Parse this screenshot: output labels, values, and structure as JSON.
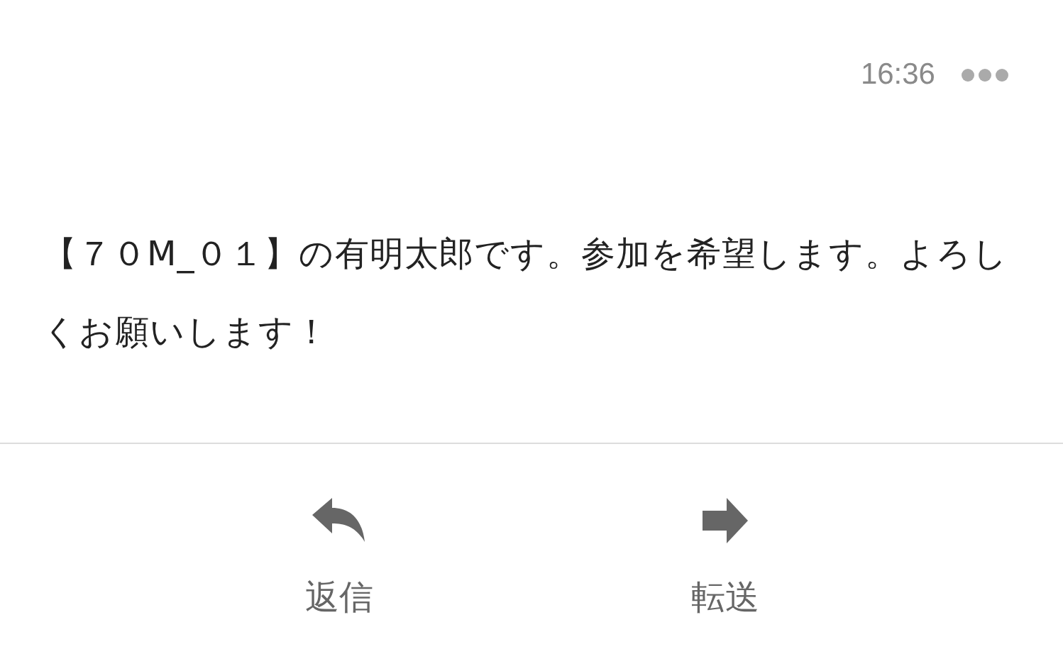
{
  "header": {
    "time": "16:36"
  },
  "message": {
    "body": "【７０M_０１】の有明太郎です。参加を希望します。よろしくお願いします！"
  },
  "actions": [
    {
      "kind": "reply",
      "label": "返信"
    },
    {
      "kind": "forward",
      "label": "転送"
    }
  ]
}
